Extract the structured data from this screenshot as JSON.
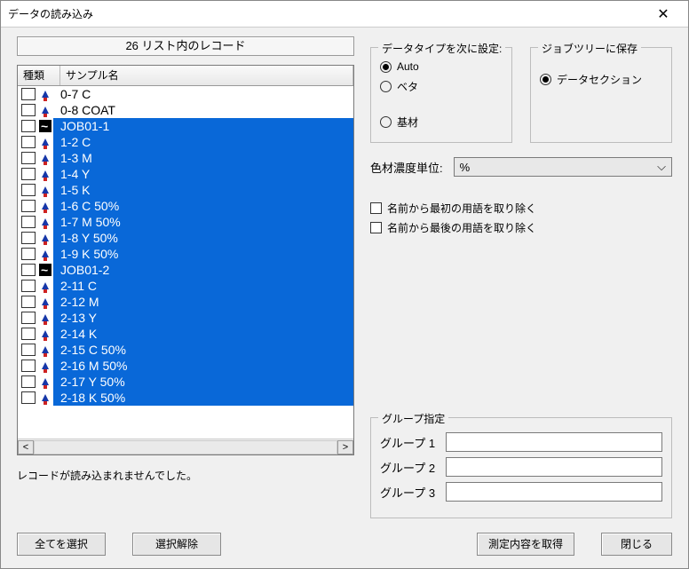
{
  "window": {
    "title": "データの読み込み"
  },
  "left": {
    "record_header": "26 リスト内のレコード",
    "col_type": "種類",
    "col_name": "サンプル名",
    "rows": [
      {
        "icon": "up",
        "name": "0-7 C",
        "selected": false
      },
      {
        "icon": "up",
        "name": "0-8 COAT",
        "selected": false
      },
      {
        "icon": "wave",
        "name": "JOB01-1",
        "selected": true
      },
      {
        "icon": "up",
        "name": "1-2 C",
        "selected": true
      },
      {
        "icon": "up",
        "name": "1-3 M",
        "selected": true
      },
      {
        "icon": "up",
        "name": "1-4 Y",
        "selected": true
      },
      {
        "icon": "up",
        "name": "1-5 K",
        "selected": true
      },
      {
        "icon": "up",
        "name": "1-6 C 50%",
        "selected": true
      },
      {
        "icon": "up",
        "name": "1-7 M 50%",
        "selected": true
      },
      {
        "icon": "up",
        "name": "1-8 Y 50%",
        "selected": true
      },
      {
        "icon": "up",
        "name": "1-9 K 50%",
        "selected": true
      },
      {
        "icon": "wave",
        "name": "JOB01-2",
        "selected": true
      },
      {
        "icon": "up",
        "name": "2-11 C",
        "selected": true
      },
      {
        "icon": "up",
        "name": "2-12 M",
        "selected": true
      },
      {
        "icon": "up",
        "name": "2-13 Y",
        "selected": true
      },
      {
        "icon": "up",
        "name": "2-14 K",
        "selected": true
      },
      {
        "icon": "up",
        "name": "2-15 C 50%",
        "selected": true
      },
      {
        "icon": "up",
        "name": "2-16 M 50%",
        "selected": true
      },
      {
        "icon": "up",
        "name": "2-17 Y 50%",
        "selected": true
      },
      {
        "icon": "up",
        "name": "2-18 K 50%",
        "selected": true
      }
    ],
    "status": "レコードが読み込まれませんでした。"
  },
  "right": {
    "dtype_group": {
      "legend": "データタイプを次に設定:",
      "opts": [
        "Auto",
        "ベタ",
        "基材"
      ],
      "selected": 0
    },
    "save_group": {
      "legend": "ジョブツリーに保存",
      "opts": [
        "データセクション"
      ],
      "selected": 0
    },
    "unit_label": "色材濃度単位:",
    "unit_value": "%",
    "strip_first": "名前から最初の用語を取り除く",
    "strip_last": "名前から最後の用語を取り除く",
    "grp_legend": "グループ指定",
    "grp_labels": [
      "グループ 1",
      "グループ 2",
      "グループ 3"
    ]
  },
  "buttons": {
    "select_all": "全てを選択",
    "deselect": "選択解除",
    "get_measure": "測定内容を取得",
    "close": "閉じる"
  }
}
